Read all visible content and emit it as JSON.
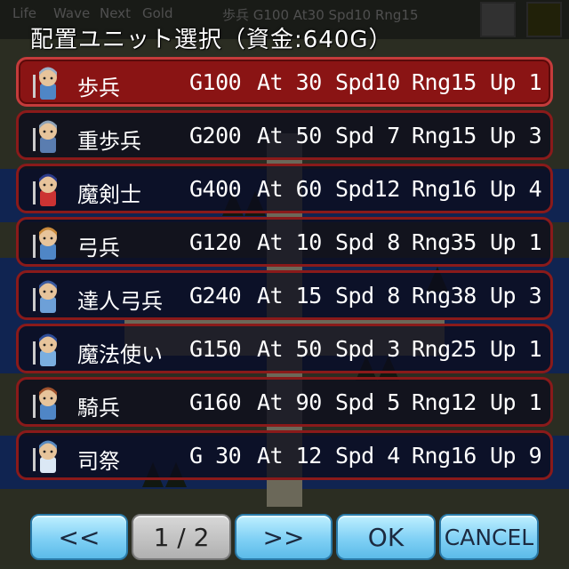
{
  "background": {
    "hud_labels": [
      "Life",
      "Wave",
      "Next",
      "Gold"
    ],
    "hud_unit_text": "歩兵 G100 At30 Spd10 Rng15"
  },
  "dialog": {
    "title": "配置ユニット選択（資金:640G）",
    "units": [
      {
        "name": "歩兵",
        "cost": "G100",
        "at": "At 30",
        "spd": "Spd10",
        "rng": "Rng15",
        "up": "Up 1",
        "selected": true,
        "icon": "infantry-icon"
      },
      {
        "name": "重歩兵",
        "cost": "G200",
        "at": "At 50",
        "spd": "Spd 7",
        "rng": "Rng15",
        "up": "Up 3",
        "selected": false,
        "icon": "heavy-infantry-icon"
      },
      {
        "name": "魔剣士",
        "cost": "G400",
        "at": "At 60",
        "spd": "Spd12",
        "rng": "Rng16",
        "up": "Up 4",
        "selected": false,
        "icon": "magic-swordsman-icon"
      },
      {
        "name": "弓兵",
        "cost": "G120",
        "at": "At 10",
        "spd": "Spd 8",
        "rng": "Rng35",
        "up": "Up 1",
        "selected": false,
        "icon": "archer-icon"
      },
      {
        "name": "達人弓兵",
        "cost": "G240",
        "at": "At 15",
        "spd": "Spd 8",
        "rng": "Rng38",
        "up": "Up 3",
        "selected": false,
        "icon": "master-archer-icon"
      },
      {
        "name": "魔法使い",
        "cost": "G150",
        "at": "At 50",
        "spd": "Spd 3",
        "rng": "Rng25",
        "up": "Up 1",
        "selected": false,
        "icon": "mage-icon"
      },
      {
        "name": "騎兵",
        "cost": "G160",
        "at": "At 90",
        "spd": "Spd 5",
        "rng": "Rng12",
        "up": "Up 1",
        "selected": false,
        "icon": "cavalry-icon"
      },
      {
        "name": "司祭",
        "cost": "G 30",
        "at": "At 12",
        "spd": "Spd 4",
        "rng": "Rng16",
        "up": "Up 9",
        "selected": false,
        "icon": "priest-icon"
      }
    ]
  },
  "buttons": {
    "prev": "<<",
    "page": "1 / 2",
    "next": ">>",
    "ok": "OK",
    "cancel": "CANCEL"
  },
  "colors": {
    "selected_row": "#8a1414",
    "row_border": "#8a1a1a",
    "button_blue": "#7fd0f5"
  }
}
